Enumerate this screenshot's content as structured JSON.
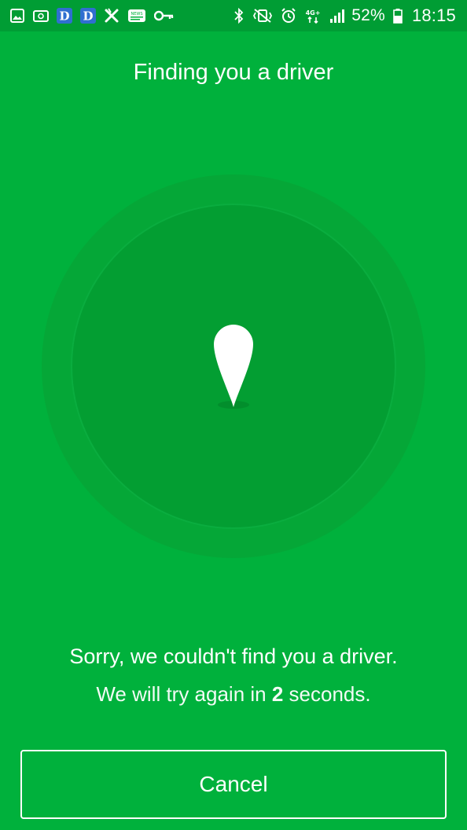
{
  "status_bar": {
    "left_icons": [
      "gallery-icon",
      "cast-icon",
      "app-d-icon",
      "app-d-icon",
      "app-x-icon",
      "news-icon",
      "key-icon"
    ],
    "right_icons": [
      "bluetooth-icon",
      "vibrate-icon",
      "alarm-icon",
      "network-4g-icon",
      "signal-icon",
      "battery-icon"
    ],
    "network_label": "4G+",
    "battery_percent": "52%",
    "time": "18:15",
    "news_badge": "NEWS"
  },
  "header": {
    "title": "Finding you a driver"
  },
  "search": {
    "pin_icon": "location-pin-icon",
    "message_primary": "Sorry, we couldn't find you a driver.",
    "retry_prefix": "We will try again in ",
    "retry_seconds": "2",
    "retry_suffix": " seconds."
  },
  "actions": {
    "cancel_label": "Cancel"
  },
  "colors": {
    "background": "#00b13c",
    "status_bar": "#009d34",
    "radar_outer": "#05a737",
    "radar_inner": "#039e32",
    "text": "#ffffff"
  }
}
